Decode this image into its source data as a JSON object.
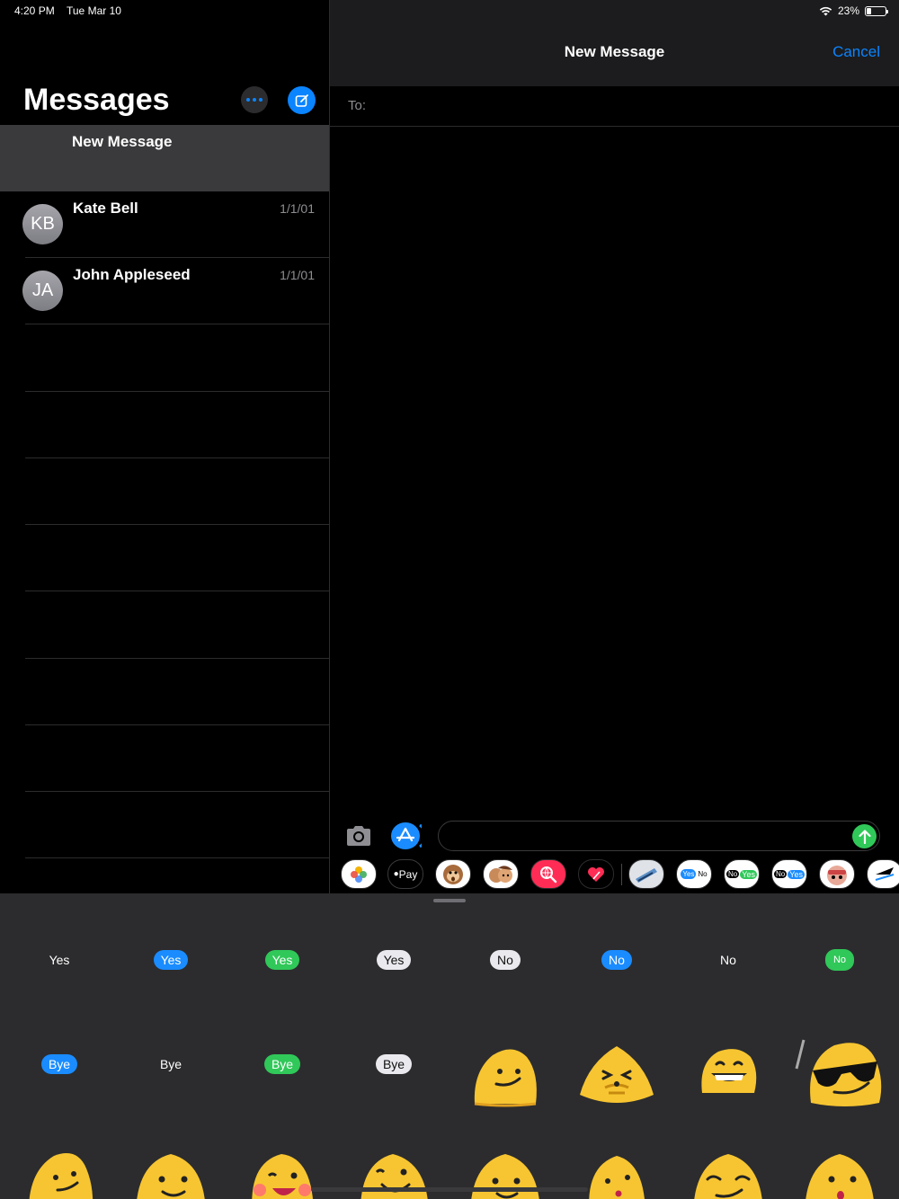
{
  "status_bar": {
    "time": "4:20 PM",
    "date": "Tue Mar 10",
    "battery": "23%"
  },
  "sidebar": {
    "title": "Messages",
    "new_message_label": "New Message",
    "conversations": [
      {
        "initials": "KB",
        "name": "Kate Bell",
        "date": "1/1/01"
      },
      {
        "initials": "JA",
        "name": "John Appleseed",
        "date": "1/1/01"
      }
    ]
  },
  "compose": {
    "title": "New Message",
    "cancel_label": "Cancel",
    "to_label": "To:",
    "input_value": ""
  },
  "app_drawer": {
    "items": [
      "photos-icon",
      "apple-pay-icon",
      "animoji-monkey-icon",
      "memoji-icon",
      "web-search-icon",
      "digital-touch-icon",
      "sticker-app-icon",
      "yes-no-sticker-icon",
      "no-yes-green-sticker-icon",
      "no-yes-blue-sticker-icon",
      "character-sticker-icon",
      "arrows-sticker-icon"
    ],
    "apple_pay_label": "Pay",
    "yes_label": "Yes",
    "no_label": "No"
  },
  "stickers": {
    "pills": [
      {
        "text": "Yes",
        "style": "plain"
      },
      {
        "text": "Yes",
        "style": "blue"
      },
      {
        "text": "Yes",
        "style": "green"
      },
      {
        "text": "Yes",
        "style": "white"
      },
      {
        "text": "No",
        "style": "white"
      },
      {
        "text": "No",
        "style": "blue"
      },
      {
        "text": "No",
        "style": "plain"
      },
      {
        "text": "No",
        "style": "green"
      },
      {
        "text": "Bye",
        "style": "blue"
      },
      {
        "text": "Bye",
        "style": "plain"
      },
      {
        "text": "Bye",
        "style": "green"
      },
      {
        "text": "Bye",
        "style": "white"
      }
    ],
    "emoji_blobs": [
      "smirk-blob-icon",
      "hug-blob-icon",
      "grin-blob-icon",
      "sunglasses-blob-icon",
      "smirk-blob-icon",
      "smile-blob-icon",
      "blush-blob-icon",
      "wink-blob-icon",
      "smile-blob-icon",
      "kiss-blob-icon",
      "relieved-blob-icon",
      "surprised-blob-icon"
    ]
  }
}
